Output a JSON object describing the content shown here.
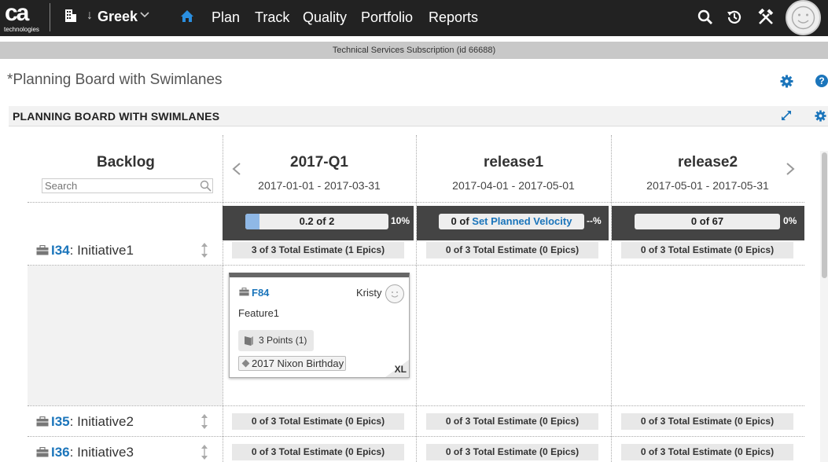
{
  "topbar": {
    "logo_main": "ca",
    "logo_sub": "technologies",
    "workspace": "Greek",
    "nav": [
      "Plan",
      "Track",
      "Quality",
      "Portfolio",
      "Reports"
    ]
  },
  "subscription": "Technical Services Subscription (id 66688)",
  "page": {
    "title": "*Planning Board with Swimlanes",
    "help": "?"
  },
  "panel": {
    "title": "PLANNING BOARD WITH SWIMLANES"
  },
  "backlog": {
    "title": "Backlog",
    "search_placeholder": "Search"
  },
  "columns": [
    {
      "title": "2017-Q1",
      "dates": "2017-01-01 - 2017-03-31",
      "velocity_label": "0.2 of 2",
      "velocity_link": "",
      "velocity_fill": 0.1,
      "velocity_pct": "10%"
    },
    {
      "title": "release1",
      "dates": "2017-04-01 - 2017-05-01",
      "velocity_label": "0 of ",
      "velocity_link": "Set Planned Velocity",
      "velocity_fill": 0,
      "velocity_pct": "--%"
    },
    {
      "title": "release2",
      "dates": "2017-05-01 - 2017-05-31",
      "velocity_label": "0 of 67",
      "velocity_link": "",
      "velocity_fill": 0,
      "velocity_pct": "0%"
    }
  ],
  "lanes": [
    {
      "id": "I34",
      "name": ": Initiative1",
      "estimates": [
        "3 of 3 Total Estimate (1 Epics)",
        "0 of 3 Total Estimate (0 Epics)",
        "0 of 3 Total Estimate (0 Epics)"
      ]
    },
    {
      "id": "I35",
      "name": ": Initiative2",
      "estimates": [
        "0 of 3 Total Estimate (0 Epics)",
        "0 of 3 Total Estimate (0 Epics)",
        "0 of 3 Total Estimate (0 Epics)"
      ]
    },
    {
      "id": "I36",
      "name": ": Initiative3",
      "estimates": [
        "0 of 3 Total Estimate (0 Epics)",
        "0 of 3 Total Estimate (0 Epics)",
        "0 of 3 Total Estimate (0 Epics)"
      ]
    }
  ],
  "card": {
    "id": "F84",
    "owner": "Kristy",
    "name": "Feature1",
    "points": "3 Points (1)",
    "milestone": "2017 Nixon Birthday",
    "size": "XL"
  },
  "colors": {
    "topbar": "#222222",
    "link": "#1b75bb",
    "velocity_fill": "#8fb8e6"
  }
}
